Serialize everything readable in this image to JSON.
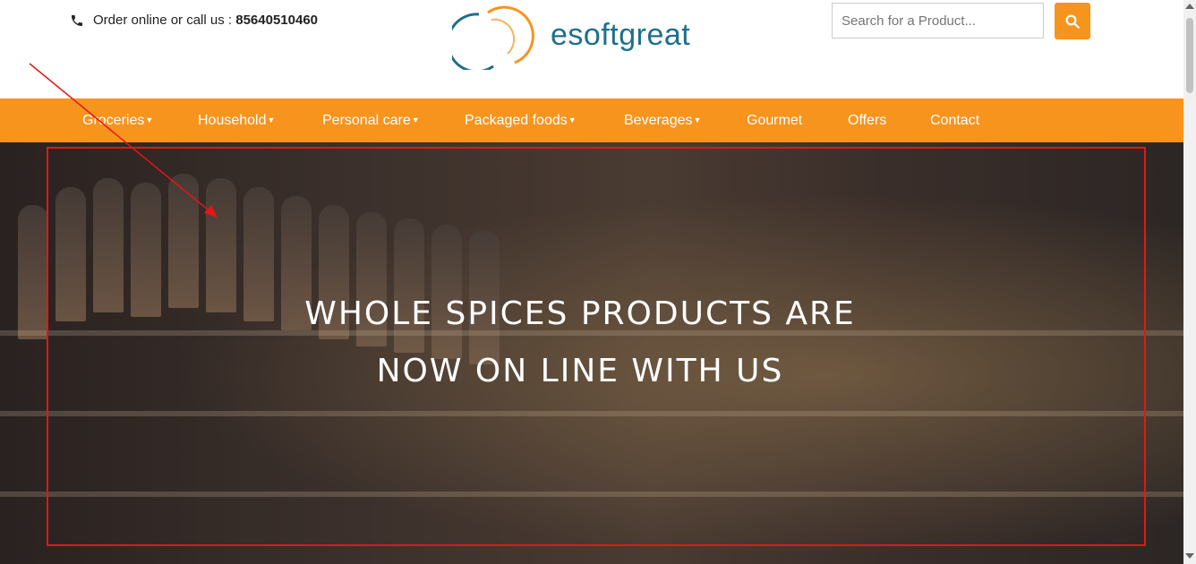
{
  "header": {
    "order_text": "Order online or call us :",
    "phone_number": "85640510460",
    "brand": "esoftgreat",
    "search_placeholder": "Search for a Product...",
    "phone_icon": "phone-icon",
    "search_icon": "search-icon"
  },
  "nav": {
    "items": [
      {
        "label": "Groceries",
        "dropdown": true
      },
      {
        "label": "Household",
        "dropdown": true
      },
      {
        "label": "Personal care",
        "dropdown": true
      },
      {
        "label": "Packaged foods",
        "dropdown": true
      },
      {
        "label": "Beverages",
        "dropdown": true
      },
      {
        "label": "Gourmet",
        "dropdown": false
      },
      {
        "label": "Offers",
        "dropdown": false
      },
      {
        "label": "Contact",
        "dropdown": false
      }
    ]
  },
  "hero": {
    "line1": "WHOLE SPICES PRODUCTS ARE",
    "line2": "NOW ON LINE WITH US"
  },
  "colors": {
    "accent": "#f7941d",
    "annotation": "#e01818",
    "brand_text": "#1f6f8b"
  }
}
